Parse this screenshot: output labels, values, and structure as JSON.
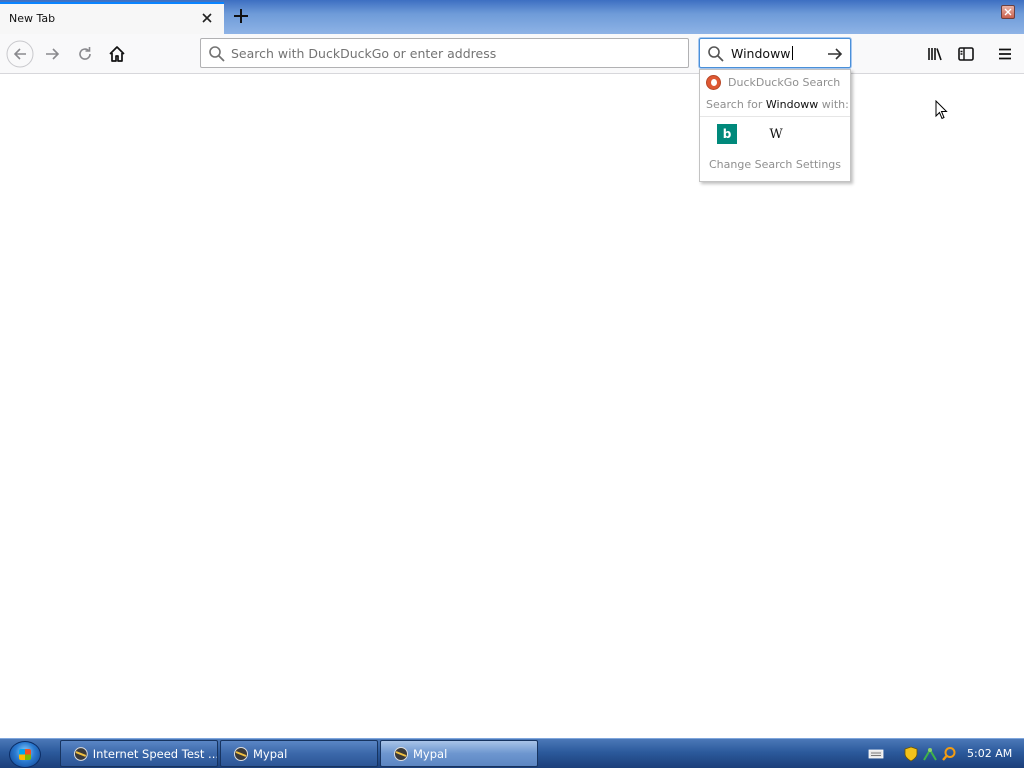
{
  "browser": {
    "tab": {
      "title": "New Tab"
    },
    "urlbar": {
      "placeholder": "Search with DuckDuckGo or enter address",
      "value": ""
    },
    "searchbar": {
      "value": "Windoww"
    },
    "search_popup": {
      "header": "DuckDuckGo Search",
      "search_for_prefix": "Search for ",
      "search_for_query": "Windoww",
      "search_for_suffix": " with:",
      "engines": [
        {
          "name": "Bing",
          "glyph": "b",
          "icon": "bing-icon"
        },
        {
          "name": "Wikipedia",
          "glyph": "W",
          "icon": "wikipedia-icon"
        }
      ],
      "settings_label": "Change Search Settings"
    }
  },
  "taskbar": {
    "buttons": [
      {
        "label": "Internet Speed Test ...",
        "active": false
      },
      {
        "label": "Mypal",
        "active": false
      },
      {
        "label": "Mypal",
        "active": true
      }
    ],
    "clock": "5:02 AM"
  },
  "colors": {
    "accent": "#0a84ff",
    "bing": "#00897b",
    "duckduckgo": "#de5833"
  }
}
